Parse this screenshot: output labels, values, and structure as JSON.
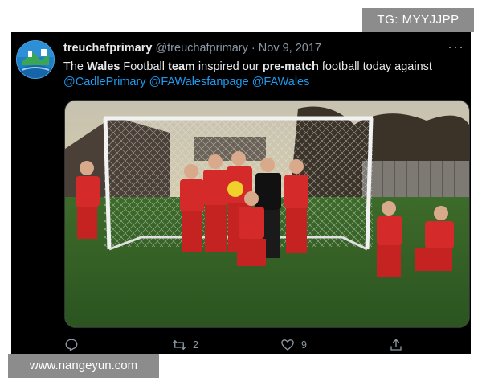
{
  "watermark_top": "TG: MYYJJPP",
  "watermark_bottom": "www.nangeyun.com",
  "tweet": {
    "author": "treuchafprimary",
    "handle": "@treuchafprimary",
    "separator": "·",
    "date": "Nov 9, 2017",
    "text": {
      "p1": "The ",
      "b1": "Wales",
      "p2": " Football ",
      "b2": "team",
      "p3": " inspired our ",
      "b3": "pre-match",
      "p4": " football today against",
      "mentions": [
        "@CadlePrimary",
        "@FAWalesfanpage",
        "@FAWales"
      ]
    },
    "actions": {
      "reply_count": "",
      "retweet_count": "2",
      "like_count": "9"
    }
  },
  "colors": {
    "background": "#000000",
    "text": "#e7e9ea",
    "muted": "#8b98a5",
    "mention": "#1d9bf0",
    "watermark": "#8c8c8c"
  },
  "icons": [
    "reply-icon",
    "retweet-icon",
    "like-icon",
    "share-icon",
    "more-icon"
  ]
}
